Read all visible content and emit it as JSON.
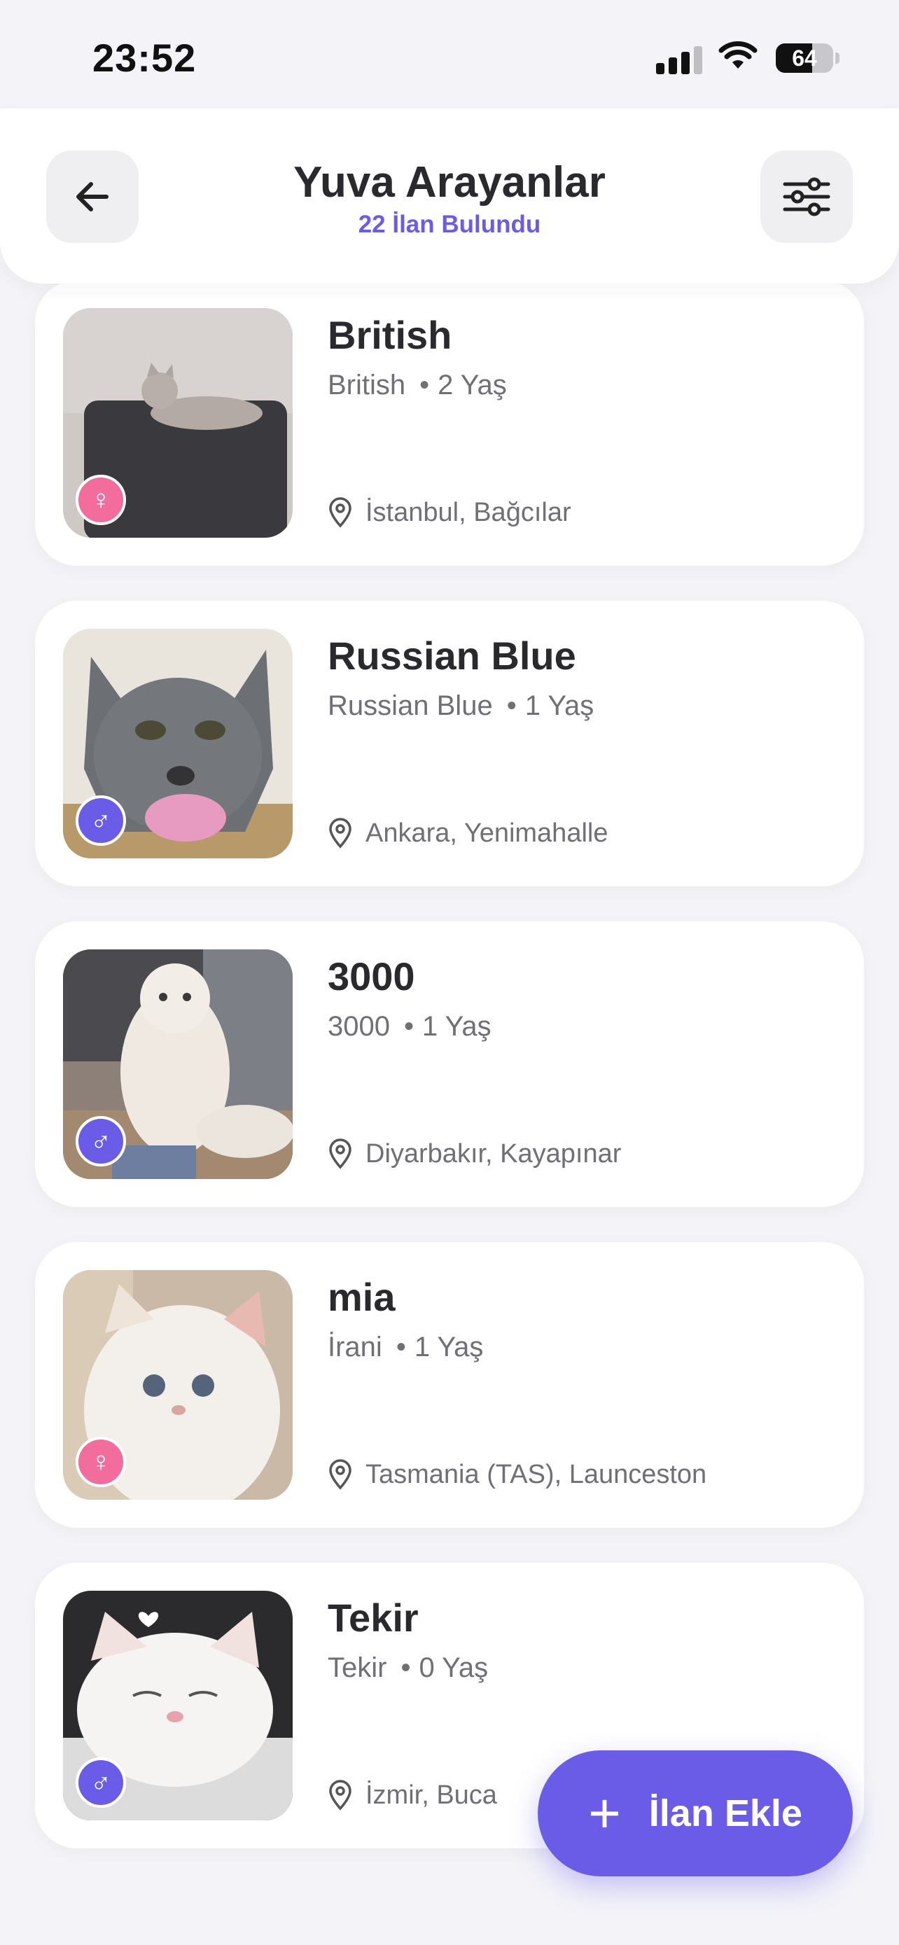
{
  "status_bar": {
    "time": "23:52",
    "battery": "64",
    "icons": [
      "signal-icon",
      "wifi-icon",
      "battery-icon"
    ]
  },
  "header": {
    "title": "Yuva Arayanlar",
    "subtitle": "22 İlan Bulundu",
    "back_icon": "arrow-left-icon",
    "filter_icon": "sliders-icon"
  },
  "listings": [
    {
      "name": "British",
      "breed": "British",
      "age": "2 Yaş",
      "location": "İstanbul, Bağcılar",
      "gender_icon": "female-icon",
      "gender_symbol": "♀"
    },
    {
      "name": "Russian Blue",
      "breed": "Russian Blue",
      "age": "1 Yaş",
      "location": "Ankara, Yenimahalle",
      "gender_icon": "male-icon",
      "gender_symbol": "♂"
    },
    {
      "name": "3000",
      "breed": "3000",
      "age": "1 Yaş",
      "location": "Diyarbakır, Kayapınar",
      "gender_icon": "male-icon",
      "gender_symbol": "♂"
    },
    {
      "name": "mia",
      "breed": "İrani",
      "age": "1 Yaş",
      "location": "Tasmania (TAS), Launceston",
      "gender_icon": "female-icon",
      "gender_symbol": "♀"
    },
    {
      "name": "Tekir",
      "breed": "Tekir",
      "age": "0 Yaş",
      "location": "İzmir, Buca",
      "gender_icon": "male-icon",
      "gender_symbol": "♂"
    }
  ],
  "fab": {
    "label": "İlan Ekle",
    "icon": "plus-icon"
  },
  "colors": {
    "accent": "#6b5ce7",
    "female": "#f26d9b",
    "background": "#f3f3f8"
  }
}
